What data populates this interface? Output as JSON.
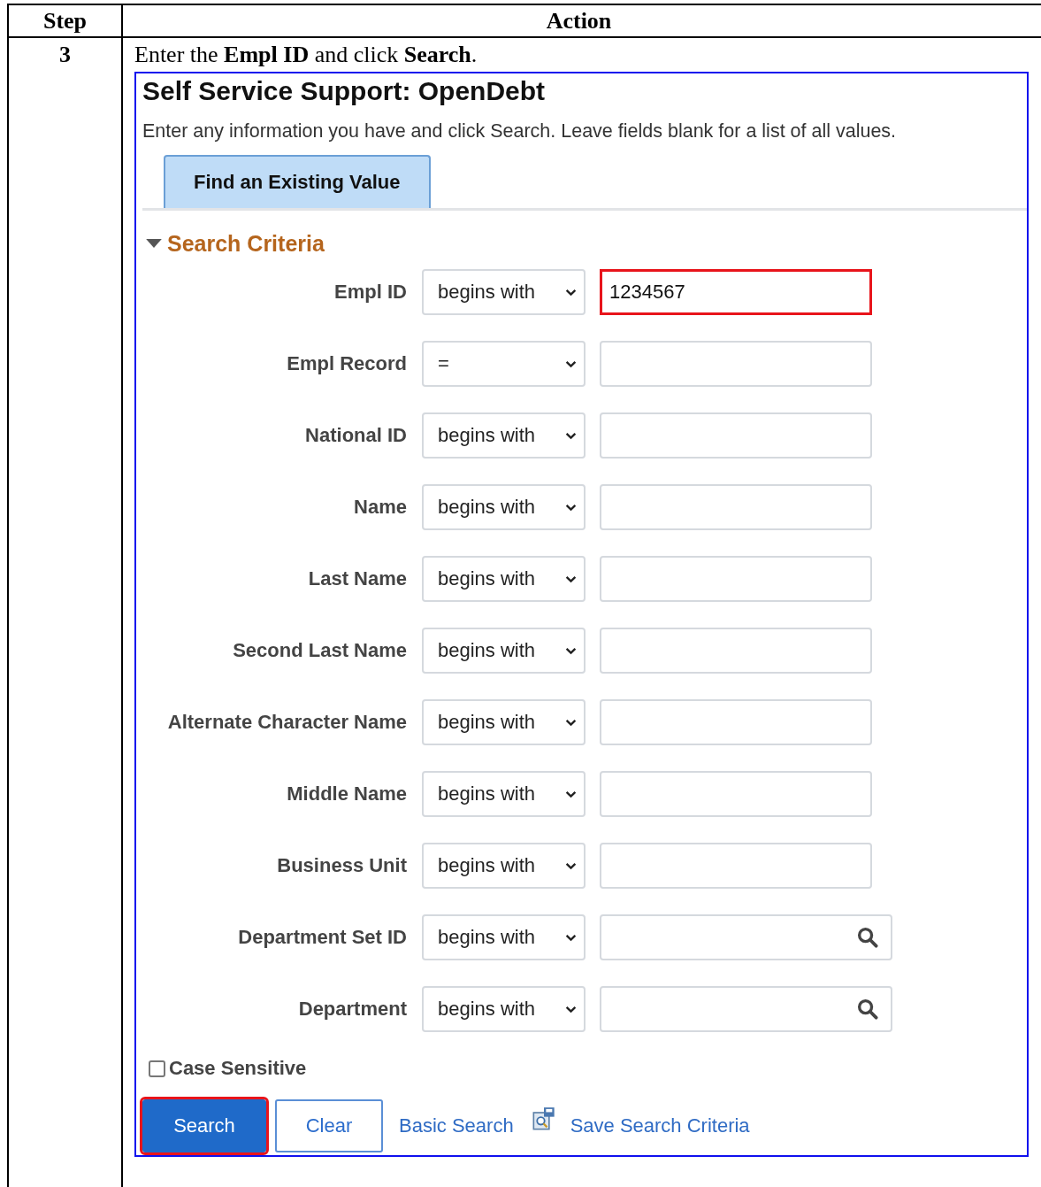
{
  "table": {
    "columns": [
      "Step",
      "Action"
    ],
    "rows": [
      {
        "step": "3",
        "instruction": "Enter the **Empl ID** and click **Search**.",
        "screen": {
          "title": "Self Service Support: OpenDebt",
          "hint": "Enter any information you have and click Search. Leave fields blank for a list of all values.",
          "tabs": [
            {
              "label": "Find an Existing Value",
              "selected": true
            }
          ],
          "section": {
            "label": "Search Criteria",
            "expanded": true
          },
          "fields": [
            {
              "label": "Empl ID",
              "operator": "begins with",
              "value": "1234567",
              "lookup": false,
              "highlighted": true
            },
            {
              "label": "Empl Record",
              "operator": "=",
              "lookup": false,
              "highlighted": false
            },
            {
              "label": "National ID",
              "operator": "begins with",
              "lookup": false,
              "highlighted": false
            },
            {
              "label": "Name",
              "operator": "begins with",
              "lookup": false,
              "highlighted": false
            },
            {
              "label": "Last Name",
              "operator": "begins with",
              "lookup": false,
              "highlighted": false
            },
            {
              "label": "Second Last Name",
              "operator": "begins with",
              "lookup": false,
              "highlighted": false
            },
            {
              "label": "Alternate Character Name",
              "operator": "begins with",
              "lookup": false,
              "highlighted": false
            },
            {
              "label": "Middle Name",
              "operator": "begins with",
              "lookup": false,
              "highlighted": false
            },
            {
              "label": "Business Unit",
              "operator": "begins with",
              "lookup": false,
              "highlighted": false
            },
            {
              "label": "Department Set ID",
              "operator": "begins with",
              "lookup": true,
              "highlighted": false
            },
            {
              "label": "Department",
              "operator": "begins with",
              "lookup": true,
              "highlighted": false
            }
          ],
          "case_sensitive": {
            "label": "Case Sensitive",
            "checked": false
          },
          "buttons": [
            {
              "label": "Search",
              "kind": "primary",
              "highlighted": true
            },
            {
              "label": "Clear",
              "kind": "secondary",
              "highlighted": false
            },
            {
              "label": "Basic Search",
              "kind": "link",
              "highlighted": false
            },
            {
              "label": "Save Search Criteria",
              "kind": "icon-link",
              "highlighted": false
            }
          ]
        }
      }
    ]
  }
}
